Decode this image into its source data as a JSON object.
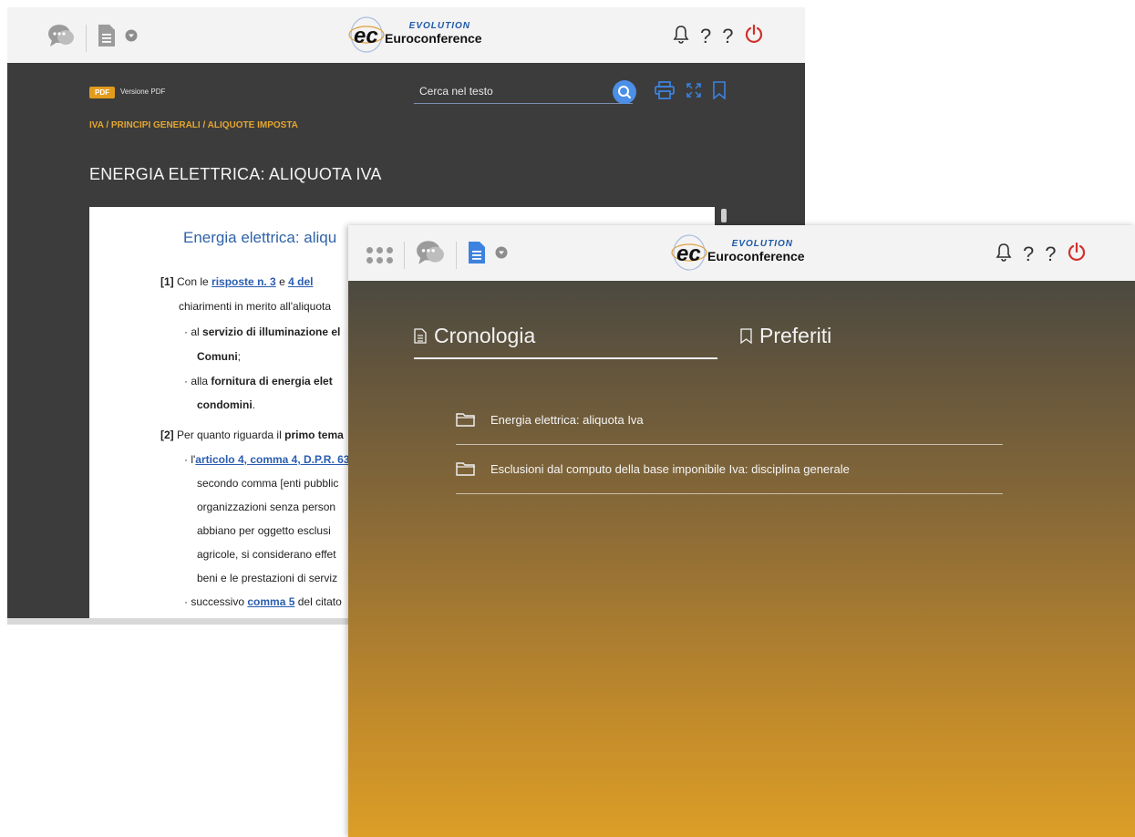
{
  "back": {
    "logo": {
      "evolution": "EVOLUTION",
      "name": "Euroconference"
    },
    "header_help1": "?",
    "header_help2": "?",
    "pdf": {
      "badge": "PDF",
      "label": "Versione PDF"
    },
    "search": {
      "placeholder": "Cerca nel testo"
    },
    "breadcrumb": "IVA / PRINCIPI GENERALI / ALIQUOTE IMPOSTA",
    "title": "ENERGIA ELETTRICA: ALIQUOTA IVA",
    "document": {
      "title": "Energia elettrica: aliqu",
      "p1_ref": "[1]",
      "p1_text": "Con le",
      "p1_link1": "risposte n. 3",
      "p1_and": "e",
      "p1_link2": "4 del",
      "p1_line2": "chiarimenti in merito all'aliquota",
      "b1_pre": "· al",
      "b1_bold": "servizio di illuminazione el",
      "b1_line2": "Comuni",
      "b1_line2_end": ";",
      "b2_pre": "· alla",
      "b2_bold": "fornitura di energia elet",
      "b2_line2": "condomini",
      "b2_line2_end": ".",
      "p2_ref": "[2]",
      "p2_text": "Per quanto riguarda il",
      "p2_bold": "primo tema",
      "b3_pre": "· l'",
      "b3_link": "articolo 4, comma 4, D.P.R. 63",
      "b3_l2": "secondo comma [enti pubblic",
      "b3_l3": "organizzazioni senza person",
      "b3_l4": "abbiano per oggetto esclusi",
      "b3_l5": "agricole, si considerano effet",
      "b3_l6": "beni e le prestazioni di serviz",
      "b4_pre": "· successivo",
      "b4_link": "comma 5",
      "b4_post": "del citato"
    }
  },
  "front": {
    "logo": {
      "evolution": "EVOLUTION",
      "name": "Euroconference"
    },
    "header_help1": "?",
    "header_help2": "?",
    "tabs": [
      {
        "label": "Cronologia",
        "active": true
      },
      {
        "label": "Preferiti",
        "active": false
      }
    ],
    "history": [
      "Energia elettrica: aliquota Iva",
      "Esclusioni dal computo della base imponibile Iva: disciplina generale"
    ]
  },
  "colors": {
    "accent": "#e29b1c",
    "link": "#2a5db0",
    "power": "#d0312d",
    "search_button": "#4b8fe8"
  }
}
